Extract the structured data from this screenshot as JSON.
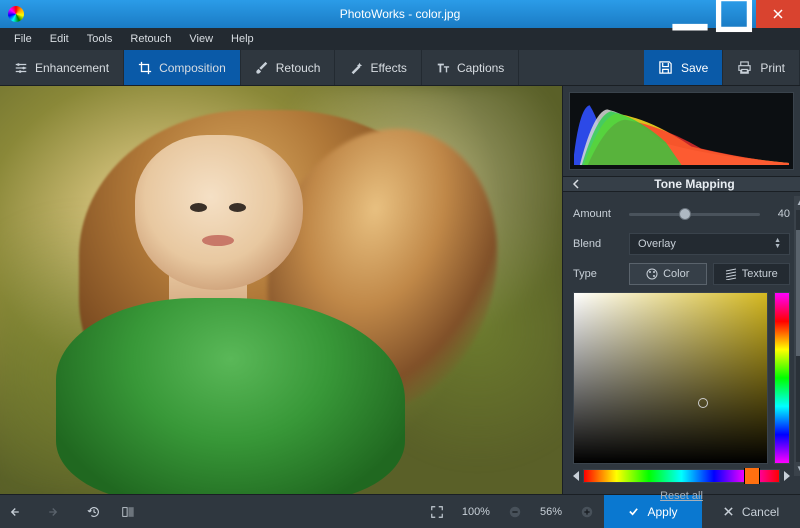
{
  "window": {
    "title": "PhotoWorks - color.jpg"
  },
  "menu": {
    "items": [
      "File",
      "Edit",
      "Tools",
      "Retouch",
      "View",
      "Help"
    ]
  },
  "toolbar": {
    "tabs": [
      {
        "label": "Enhancement"
      },
      {
        "label": "Composition"
      },
      {
        "label": "Retouch"
      },
      {
        "label": "Effects"
      },
      {
        "label": "Captions"
      }
    ],
    "active_index": 1,
    "save_label": "Save",
    "print_label": "Print"
  },
  "panel": {
    "title": "Tone Mapping",
    "amount_label": "Amount",
    "amount_value": "40",
    "blend_label": "Blend",
    "blend_value": "Overlay",
    "type_label": "Type",
    "type_color": "Color",
    "type_texture": "Texture",
    "reset_label": "Reset all"
  },
  "bottom": {
    "fit_label": "100%",
    "zoom_label": "56%",
    "apply_label": "Apply",
    "cancel_label": "Cancel"
  },
  "colors": {
    "accent": "#0a78d0",
    "tab_active": "#0a5aa8"
  }
}
